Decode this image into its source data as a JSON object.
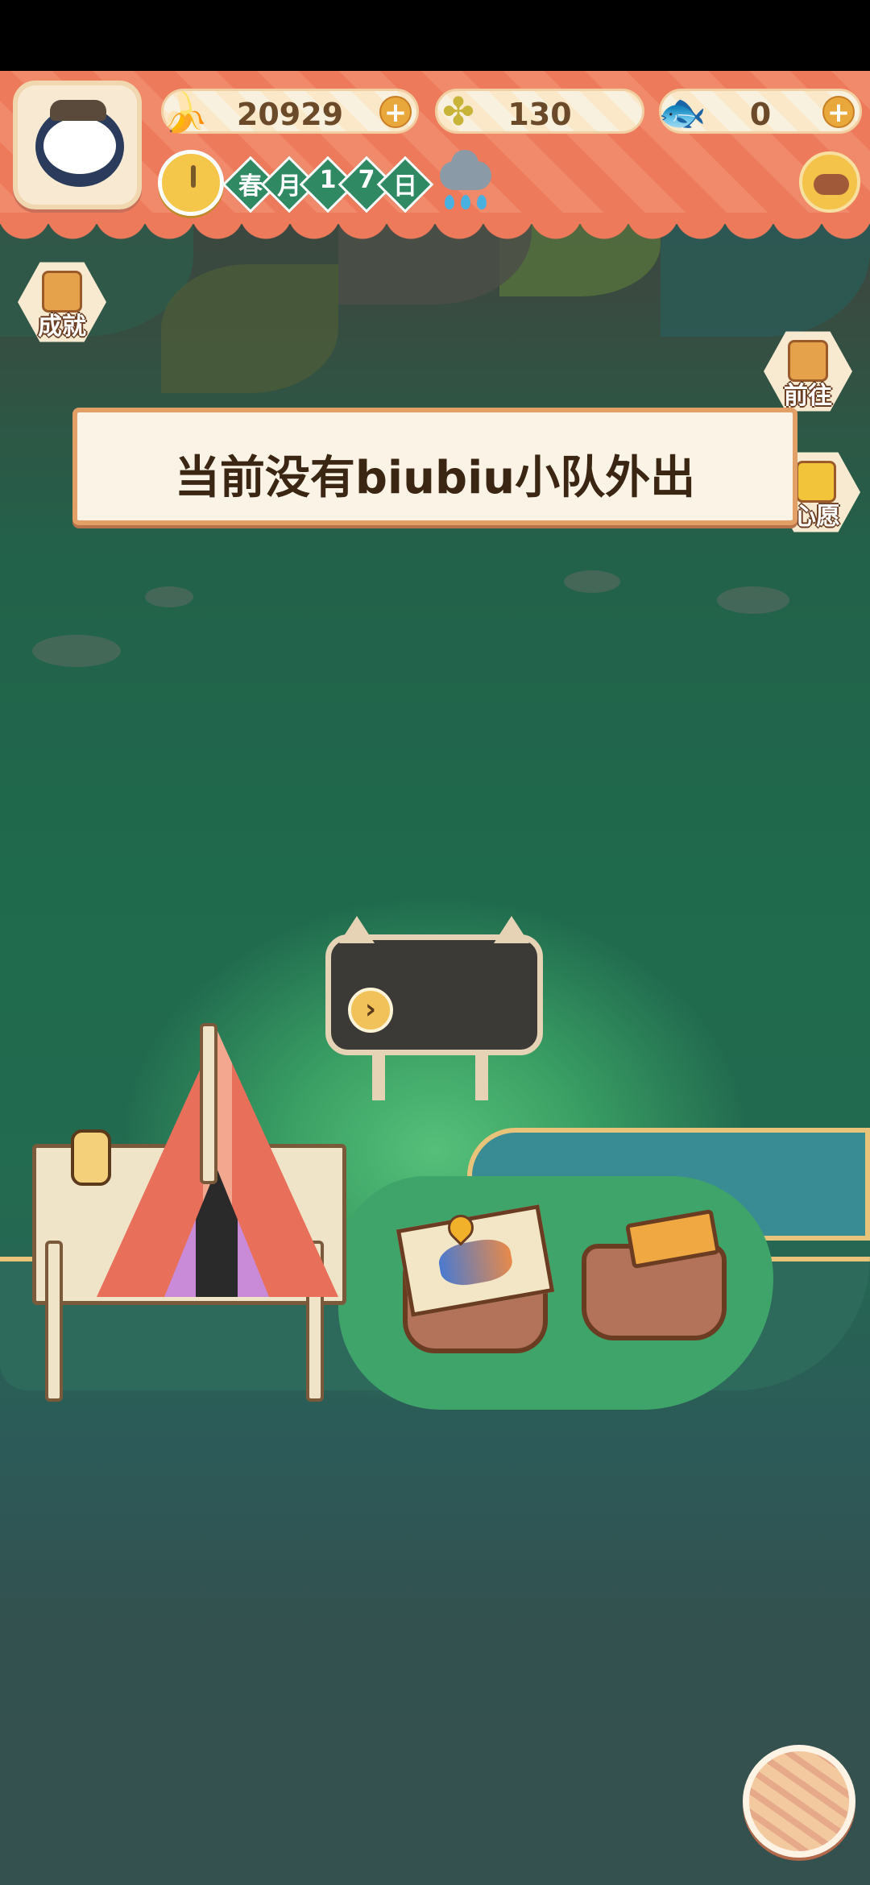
{
  "hud": {
    "bananas": "20929",
    "clovers": "130",
    "fish": "0",
    "date": {
      "season": "春",
      "month_word": "月",
      "day_tens": "1",
      "day_ones": "7",
      "day_word": "日"
    }
  },
  "side_buttons": {
    "achievements": "成就",
    "go": "前往",
    "wish": "心愿"
  },
  "toast": {
    "message": "当前没有biubiu小队外出"
  },
  "colors": {
    "banner": "#ee7a5c",
    "toast_border": "#e2a066",
    "scene_green": "#3aa064",
    "pill_plus": "#e9a83c"
  },
  "icons": {
    "avatar": "cat-avatar-icon",
    "banana": "banana-icon",
    "clover": "clover-icon",
    "fish": "fish-icon",
    "clock": "clock-icon",
    "weather": "rain-cloud-icon",
    "shop": "boar-coin-icon",
    "yarn": "yarn-ball-icon"
  }
}
